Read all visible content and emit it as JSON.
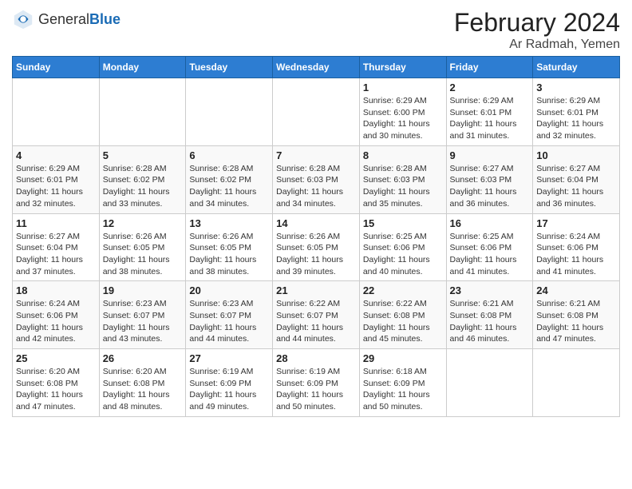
{
  "header": {
    "logo_general": "General",
    "logo_blue": "Blue",
    "title": "February 2024",
    "subtitle": "Ar Radmah, Yemen"
  },
  "columns": [
    "Sunday",
    "Monday",
    "Tuesday",
    "Wednesday",
    "Thursday",
    "Friday",
    "Saturday"
  ],
  "weeks": [
    [
      {
        "day": "",
        "detail": ""
      },
      {
        "day": "",
        "detail": ""
      },
      {
        "day": "",
        "detail": ""
      },
      {
        "day": "",
        "detail": ""
      },
      {
        "day": "1",
        "detail": "Sunrise: 6:29 AM\nSunset: 6:00 PM\nDaylight: 11 hours\nand 30 minutes."
      },
      {
        "day": "2",
        "detail": "Sunrise: 6:29 AM\nSunset: 6:01 PM\nDaylight: 11 hours\nand 31 minutes."
      },
      {
        "day": "3",
        "detail": "Sunrise: 6:29 AM\nSunset: 6:01 PM\nDaylight: 11 hours\nand 32 minutes."
      }
    ],
    [
      {
        "day": "4",
        "detail": "Sunrise: 6:29 AM\nSunset: 6:01 PM\nDaylight: 11 hours\nand 32 minutes."
      },
      {
        "day": "5",
        "detail": "Sunrise: 6:28 AM\nSunset: 6:02 PM\nDaylight: 11 hours\nand 33 minutes."
      },
      {
        "day": "6",
        "detail": "Sunrise: 6:28 AM\nSunset: 6:02 PM\nDaylight: 11 hours\nand 34 minutes."
      },
      {
        "day": "7",
        "detail": "Sunrise: 6:28 AM\nSunset: 6:03 PM\nDaylight: 11 hours\nand 34 minutes."
      },
      {
        "day": "8",
        "detail": "Sunrise: 6:28 AM\nSunset: 6:03 PM\nDaylight: 11 hours\nand 35 minutes."
      },
      {
        "day": "9",
        "detail": "Sunrise: 6:27 AM\nSunset: 6:03 PM\nDaylight: 11 hours\nand 36 minutes."
      },
      {
        "day": "10",
        "detail": "Sunrise: 6:27 AM\nSunset: 6:04 PM\nDaylight: 11 hours\nand 36 minutes."
      }
    ],
    [
      {
        "day": "11",
        "detail": "Sunrise: 6:27 AM\nSunset: 6:04 PM\nDaylight: 11 hours\nand 37 minutes."
      },
      {
        "day": "12",
        "detail": "Sunrise: 6:26 AM\nSunset: 6:05 PM\nDaylight: 11 hours\nand 38 minutes."
      },
      {
        "day": "13",
        "detail": "Sunrise: 6:26 AM\nSunset: 6:05 PM\nDaylight: 11 hours\nand 38 minutes."
      },
      {
        "day": "14",
        "detail": "Sunrise: 6:26 AM\nSunset: 6:05 PM\nDaylight: 11 hours\nand 39 minutes."
      },
      {
        "day": "15",
        "detail": "Sunrise: 6:25 AM\nSunset: 6:06 PM\nDaylight: 11 hours\nand 40 minutes."
      },
      {
        "day": "16",
        "detail": "Sunrise: 6:25 AM\nSunset: 6:06 PM\nDaylight: 11 hours\nand 41 minutes."
      },
      {
        "day": "17",
        "detail": "Sunrise: 6:24 AM\nSunset: 6:06 PM\nDaylight: 11 hours\nand 41 minutes."
      }
    ],
    [
      {
        "day": "18",
        "detail": "Sunrise: 6:24 AM\nSunset: 6:06 PM\nDaylight: 11 hours\nand 42 minutes."
      },
      {
        "day": "19",
        "detail": "Sunrise: 6:23 AM\nSunset: 6:07 PM\nDaylight: 11 hours\nand 43 minutes."
      },
      {
        "day": "20",
        "detail": "Sunrise: 6:23 AM\nSunset: 6:07 PM\nDaylight: 11 hours\nand 44 minutes."
      },
      {
        "day": "21",
        "detail": "Sunrise: 6:22 AM\nSunset: 6:07 PM\nDaylight: 11 hours\nand 44 minutes."
      },
      {
        "day": "22",
        "detail": "Sunrise: 6:22 AM\nSunset: 6:08 PM\nDaylight: 11 hours\nand 45 minutes."
      },
      {
        "day": "23",
        "detail": "Sunrise: 6:21 AM\nSunset: 6:08 PM\nDaylight: 11 hours\nand 46 minutes."
      },
      {
        "day": "24",
        "detail": "Sunrise: 6:21 AM\nSunset: 6:08 PM\nDaylight: 11 hours\nand 47 minutes."
      }
    ],
    [
      {
        "day": "25",
        "detail": "Sunrise: 6:20 AM\nSunset: 6:08 PM\nDaylight: 11 hours\nand 47 minutes."
      },
      {
        "day": "26",
        "detail": "Sunrise: 6:20 AM\nSunset: 6:08 PM\nDaylight: 11 hours\nand 48 minutes."
      },
      {
        "day": "27",
        "detail": "Sunrise: 6:19 AM\nSunset: 6:09 PM\nDaylight: 11 hours\nand 49 minutes."
      },
      {
        "day": "28",
        "detail": "Sunrise: 6:19 AM\nSunset: 6:09 PM\nDaylight: 11 hours\nand 50 minutes."
      },
      {
        "day": "29",
        "detail": "Sunrise: 6:18 AM\nSunset: 6:09 PM\nDaylight: 11 hours\nand 50 minutes."
      },
      {
        "day": "",
        "detail": ""
      },
      {
        "day": "",
        "detail": ""
      }
    ]
  ]
}
